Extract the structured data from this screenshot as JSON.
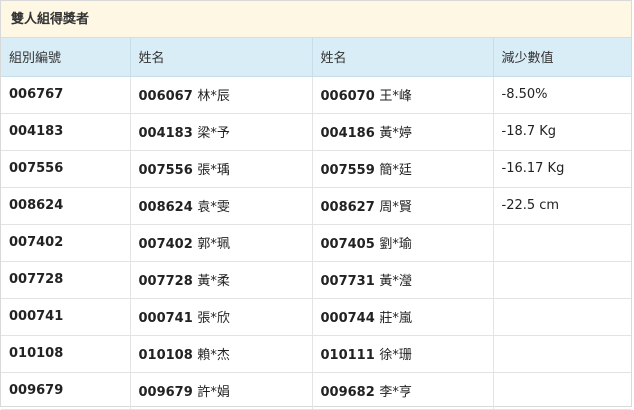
{
  "panel": {
    "title": "雙人組得獎者"
  },
  "table": {
    "headers": [
      "組別編號",
      "姓名",
      "姓名",
      "減少數值"
    ],
    "rows": [
      {
        "group": "006767",
        "p1_id": "006067",
        "p1_name": "林*辰",
        "p2_id": "006070",
        "p2_name": "王*峰",
        "reduction": "-8.50%"
      },
      {
        "group": "004183",
        "p1_id": "004183",
        "p1_name": "梁*予",
        "p2_id": "004186",
        "p2_name": "黃*婷",
        "reduction": "-18.7 Kg"
      },
      {
        "group": "007556",
        "p1_id": "007556",
        "p1_name": "張*瑀",
        "p2_id": "007559",
        "p2_name": "簡*廷",
        "reduction": "-16.17 Kg"
      },
      {
        "group": "008624",
        "p1_id": "008624",
        "p1_name": "袁*雯",
        "p2_id": "008627",
        "p2_name": "周*賢",
        "reduction": "-22.5 cm"
      },
      {
        "group": "007402",
        "p1_id": "007402",
        "p1_name": "郭*珮",
        "p2_id": "007405",
        "p2_name": "劉*瑜",
        "reduction": ""
      },
      {
        "group": "007728",
        "p1_id": "007728",
        "p1_name": "黃*柔",
        "p2_id": "007731",
        "p2_name": "黃*瀅",
        "reduction": ""
      },
      {
        "group": "000741",
        "p1_id": "000741",
        "p1_name": "張*欣",
        "p2_id": "000744",
        "p2_name": "莊*嵐",
        "reduction": ""
      },
      {
        "group": "010108",
        "p1_id": "010108",
        "p1_name": "賴*杰",
        "p2_id": "010111",
        "p2_name": "徐*珊",
        "reduction": ""
      },
      {
        "group": "009679",
        "p1_id": "009679",
        "p1_name": "許*娟",
        "p2_id": "009682",
        "p2_name": "李*亨",
        "reduction": ""
      }
    ]
  },
  "colors": {
    "title_bg": "#fdf7e3",
    "header_bg": "#d9edf7",
    "border": "#e3e3e3"
  }
}
